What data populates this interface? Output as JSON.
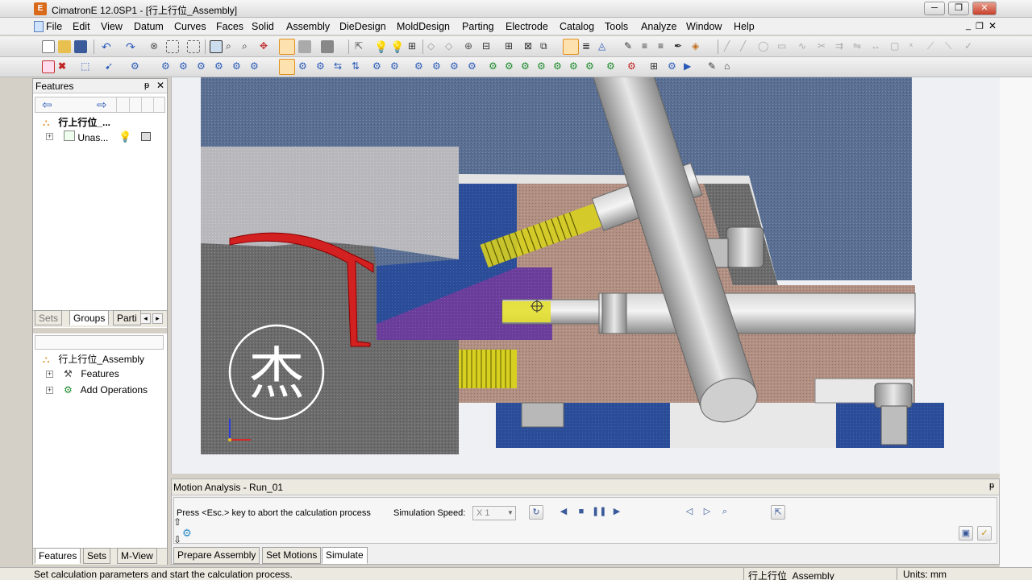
{
  "window": {
    "title": "CimatronE 12.0SP1  - [行上行位_Assembly]",
    "app_icon": "cimatron-logo-icon",
    "minimize": "─",
    "restore": "❐",
    "close": "✕"
  },
  "menu": {
    "items": [
      "File",
      "Edit",
      "View",
      "Datum",
      "Curves",
      "Faces",
      "Solid",
      "Assembly",
      "DieDesign",
      "MoldDesign",
      "Parting",
      "Electrode",
      "Catalog",
      "Tools",
      "Analyze",
      "Window",
      "Help"
    ]
  },
  "features_panel": {
    "title": "Features",
    "pin": "ᵽ",
    "close": "✕",
    "back_arrow": "⇦",
    "forward_arrow": "⇨",
    "root_label": "行上行位_...",
    "child_label": "Unas...",
    "tabs": [
      "Sets",
      "Groups",
      "Parti"
    ]
  },
  "groups_tree": {
    "root_label": "行上行位_Assembly",
    "items": [
      "Features",
      "Add Operations"
    ]
  },
  "bottom_tabs": [
    "Features",
    "Sets",
    "M-View"
  ],
  "motion_analysis": {
    "title": "Motion Analysis - Run_01",
    "message": "Press <Esc.> key to abort the calculation process",
    "speed_label": "Simulation Speed:",
    "speed_value": "X 1",
    "tabs": [
      "Prepare Assembly",
      "Set Motions",
      "Simulate"
    ],
    "active_tab": "Simulate"
  },
  "status": {
    "message": "Set calculation parameters and start the calculation process.",
    "assembly": "行上行位_Assembly",
    "units": "Units: mm"
  },
  "viewport": {
    "watermark_char": "杰"
  },
  "colors": {
    "accent_blue": "#2b5aa8",
    "purple_block": "#6a3d9a",
    "red_part": "#d32020",
    "pink_body": "#b89488",
    "grey_part": "#6a6a6a",
    "spring_yellow": "#d8d020"
  }
}
